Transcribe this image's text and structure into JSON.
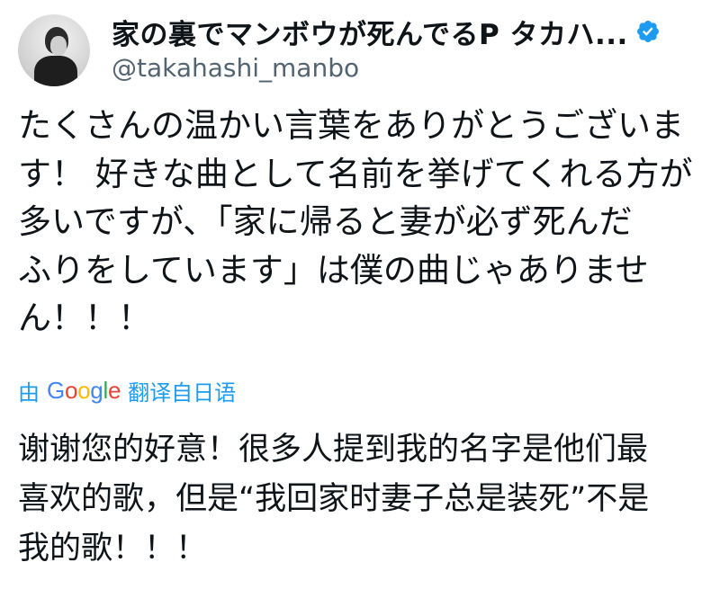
{
  "header": {
    "display_name": "家の裏でマンボウが死んでるP タカハ...",
    "handle": "@takahashi_manbo",
    "avatar_icon": "avatar",
    "verified_icon": "verified-badge-icon",
    "verified_color": "#1d9bf0"
  },
  "tweet": {
    "lines": [
      "たくさんの温かい言葉をありがとうございま",
      "す！ 好きな曲として名前を挙げてくれる方が",
      "多いですが、「家に帰ると妻が必ず死んだ",
      "ふりをしています」は僕の曲じゃありませ",
      "ん！！！"
    ]
  },
  "translation": {
    "by_label": "由",
    "google_letters": [
      "G",
      "o",
      "o",
      "g",
      "l",
      "e"
    ],
    "from_label": "翻译自日语",
    "link_color": "#1d9bf0",
    "lines": [
      "谢谢您的好意！很多人提到我的名字是他们最",
      "喜欢的歌，但是“我回家时妻子总是装死”不是",
      "我的歌！！！"
    ]
  }
}
